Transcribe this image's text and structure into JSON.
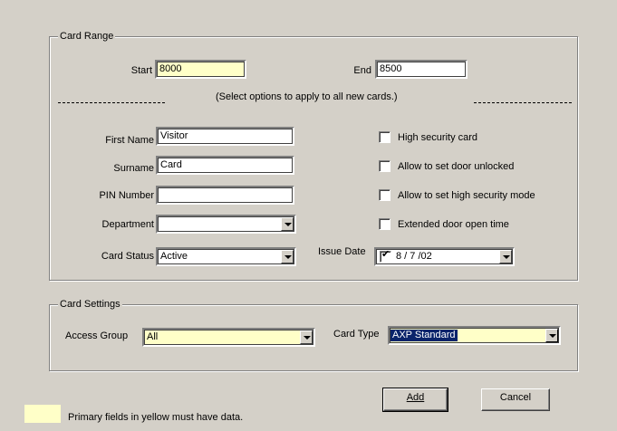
{
  "card_range": {
    "legend": "Card Range",
    "start_label": "Start",
    "start_value": "8000",
    "end_label": "End",
    "end_value": "8500",
    "options_note": "(Select options to apply to all new cards.)",
    "first_name_label": "First Name",
    "first_name_value": "Visitor",
    "surname_label": "Surname",
    "surname_value": "Card",
    "pin_label": "PIN Number",
    "pin_value": "",
    "department_label": "Department",
    "department_value": "",
    "card_status_label": "Card Status",
    "card_status_value": "Active",
    "issue_date_label": "Issue Date",
    "issue_date_value": "8 / 7 /02",
    "issue_date_checked": true,
    "checkboxes": [
      {
        "label": "High security card",
        "checked": false
      },
      {
        "label": "Allow to set door unlocked",
        "checked": false
      },
      {
        "label": "Allow to set high security mode",
        "checked": false
      },
      {
        "label": "Extended door open time",
        "checked": false
      }
    ]
  },
  "card_settings": {
    "legend": "Card Settings",
    "access_group_label": "Access Group",
    "access_group_value": "All",
    "card_type_label": "Card Type",
    "card_type_value": "AXP Standard"
  },
  "buttons": {
    "add": "Add",
    "cancel": "Cancel"
  },
  "footer": {
    "note": "Primary fields in yellow must have data."
  },
  "colors": {
    "dialog_background": "#d4d0c8",
    "required_field": "#ffffc8",
    "selection": "#0a246a"
  }
}
